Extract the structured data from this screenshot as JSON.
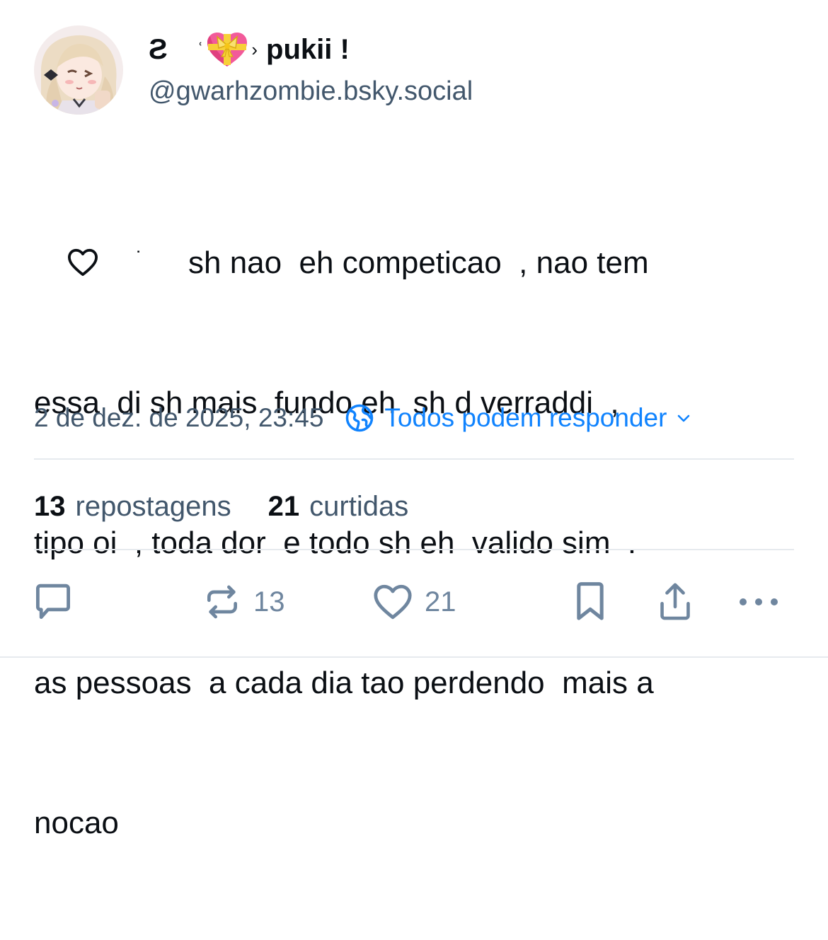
{
  "author": {
    "display_name_prefix": "Ƨ",
    "display_name_deco_left": "ʿ",
    "display_name_deco_right": "›",
    "display_name": "pukii !",
    "handle": "@gwarhzombie.bsky.social",
    "avatar_icon": "anime-girl-avatar",
    "name_emoji_icon": "heart-with-ribbon-icon"
  },
  "post": {
    "inline_icon": "heart-outline-icon",
    "inline_dot": "˙",
    "lines": [
      "sh nao  eh competicao  , nao tem",
      "essa  di sh mais  fundo eh  sh d verraddi  ,",
      "tipo oi  , toda dor  e todo sh eh  valido sim  .",
      "as pessoas  a cada dia tao perdendo  mais a",
      "nocao"
    ]
  },
  "meta": {
    "timestamp": "2 de dez. de 2025, 23:45",
    "reply_setting": "Todos podem responder"
  },
  "stats": {
    "reposts_count": "13",
    "reposts_label": "repostagens",
    "likes_count": "21",
    "likes_label": "curtidas"
  },
  "actions": {
    "repost_count": "13",
    "like_count": "21"
  },
  "colors": {
    "text": "#0b0f14",
    "muted": "#42576c",
    "accent": "#1083fe",
    "icon": "#6f869f",
    "divider": "#e6eaee"
  }
}
